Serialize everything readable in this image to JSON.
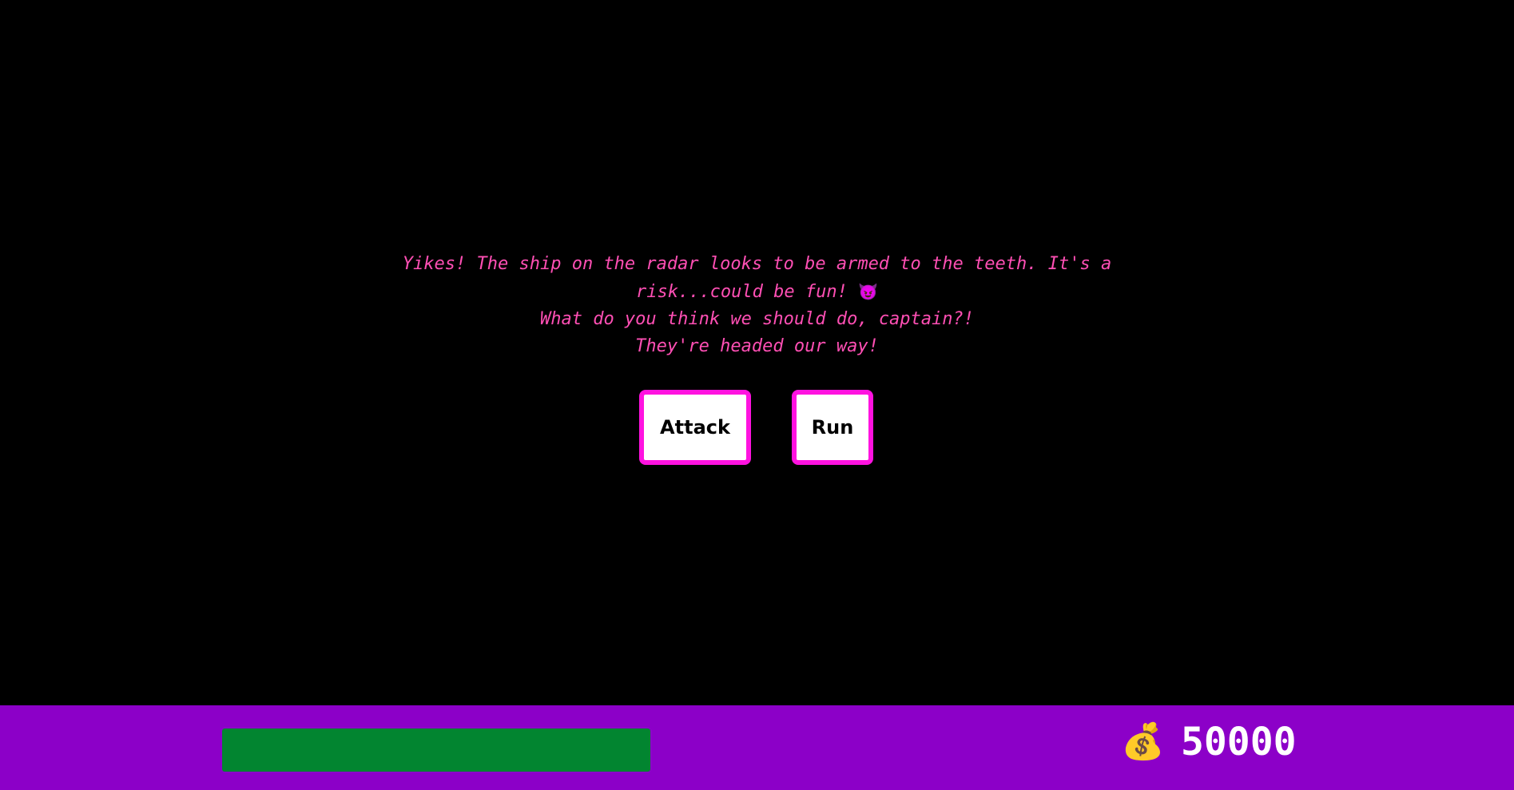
{
  "story": {
    "line1": "Yikes! The ship on the radar looks to be armed to the teeth. It's a risk...could be fun!",
    "line1_emoji": "😈",
    "line2": "What do you think we should do, captain?!",
    "line3": "They're headed our way!"
  },
  "choices": {
    "attack_label": "Attack",
    "run_label": "Run"
  },
  "status": {
    "health_fraction": 1.0,
    "money_icon": "money-bag-icon",
    "money_glyph": "💰",
    "money": "50000"
  },
  "colors": {
    "background": "#000000",
    "story_text": "#ff4fb4",
    "button_border": "#ff12e0",
    "status_bar": "#8c00c8",
    "health": "#028530"
  }
}
